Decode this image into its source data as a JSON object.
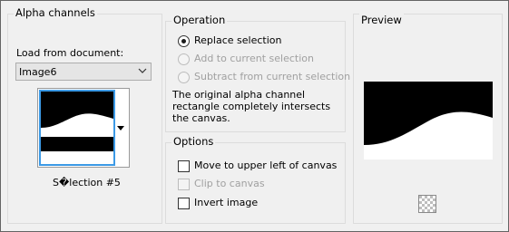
{
  "alpha_channels": {
    "title": "Alpha channels",
    "load_label": "Load from document:",
    "document_select_value": "Image6",
    "selection_name": "S�lection #5"
  },
  "operation": {
    "title": "Operation",
    "options": [
      {
        "label": "Replace selection",
        "checked": true,
        "enabled": true
      },
      {
        "label": "Add to current selection",
        "checked": false,
        "enabled": false
      },
      {
        "label": "Subtract from current selection",
        "checked": false,
        "enabled": false
      }
    ],
    "info": "The original alpha channel rectangle completely intersects the canvas."
  },
  "options": {
    "title": "Options",
    "items": [
      {
        "label": "Move to upper left of canvas",
        "checked": false,
        "enabled": true
      },
      {
        "label": "Clip to canvas",
        "checked": false,
        "enabled": false
      },
      {
        "label": "Invert image",
        "checked": false,
        "enabled": true
      }
    ]
  },
  "preview": {
    "title": "Preview",
    "transparency_icon": "checkerboard-icon"
  },
  "colors": {
    "accent": "#3c9ae6",
    "disabled_text": "#a0a0a0"
  }
}
